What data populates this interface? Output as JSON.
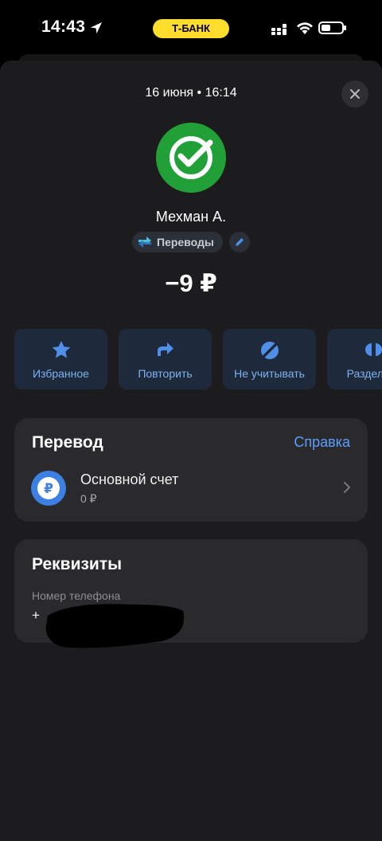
{
  "status_bar": {
    "time": "14:43",
    "bank_label": "Т-БАНК"
  },
  "header": {
    "date_time": "16 июня • 16:14",
    "close_icon": "close-icon"
  },
  "recipient": {
    "name": "Мехман А.",
    "logo": "sber-check-logo"
  },
  "category": {
    "label": "Переводы",
    "icon": "transfer-arrows-icon"
  },
  "amount": "−9 ₽",
  "actions": [
    {
      "label": "Избранное",
      "icon": "star-icon"
    },
    {
      "label": "Повторить",
      "icon": "repeat-icon"
    },
    {
      "label": "Не учитывать",
      "icon": "exclude-icon"
    },
    {
      "label": "Разделить",
      "icon": "split-icon"
    }
  ],
  "transfer": {
    "title": "Перевод",
    "help": "Справка",
    "account_name": "Основной счет",
    "account_balance": "0 ₽",
    "account_icon": "ruble-icon"
  },
  "requisites": {
    "title": "Реквизиты",
    "phone_label": "Номер телефона",
    "phone_value": "+"
  },
  "colors": {
    "accent": "#5a9eff",
    "bank_yellow": "#ffdd2d",
    "logo_green": "#21a038"
  }
}
